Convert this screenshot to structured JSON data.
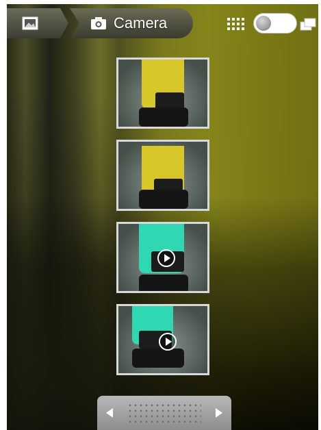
{
  "topbar": {
    "home_icon": "gallery-icon",
    "camera_icon": "camera-icon",
    "album_label": "Camera",
    "grid_icon": "grid-view-icon",
    "stack_icon": "slideshow-icon"
  },
  "thumbnails": [
    {
      "kind": "photo",
      "object_color": "#d8c62a"
    },
    {
      "kind": "photo",
      "object_color": "#d8c62a"
    },
    {
      "kind": "video",
      "object_color": "#2fd7b2"
    },
    {
      "kind": "video",
      "object_color": "#2fd7b2"
    }
  ],
  "scroller": {
    "left_icon": "arrow-left-icon",
    "right_icon": "arrow-right-icon"
  },
  "colors": {
    "background_tint": "#7b7a20",
    "frame": "#d9d9d9"
  }
}
